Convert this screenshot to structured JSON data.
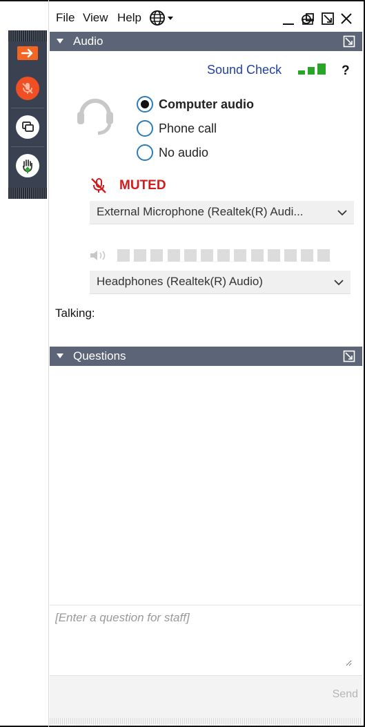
{
  "menu": {
    "file": "File",
    "view": "View",
    "help": "Help"
  },
  "window_controls": {
    "minimize_icon": "minimize-icon",
    "restore_icon": "restore-icon",
    "popout_icon": "popout-icon",
    "close_icon": "close-icon"
  },
  "toolbar": {
    "items": [
      {
        "icon": "arrow-right-icon",
        "color": "#f26522"
      },
      {
        "icon": "microphone-muted-icon",
        "color": "#f04e23"
      },
      {
        "icon": "screen-share-icon",
        "color": "#ffffff"
      },
      {
        "icon": "raise-hand-icon",
        "color": "#ffffff"
      }
    ]
  },
  "audio_panel": {
    "title": "Audio",
    "sound_check": "Sound Check",
    "help_label": "?",
    "options": [
      {
        "label": "Computer audio",
        "selected": true
      },
      {
        "label": "Phone call",
        "selected": false
      },
      {
        "label": "No audio",
        "selected": false
      }
    ],
    "mute_status": "MUTED",
    "microphone_device": "External Microphone (Realtek(R) Audi...",
    "speaker_device": "Headphones (Realtek(R) Audio)",
    "talking_label": "Talking:",
    "speaker_level_segments": 13,
    "signal_bars": 3
  },
  "questions_panel": {
    "title": "Questions",
    "input_placeholder": "[Enter a question for staff]",
    "send_label": "Send"
  },
  "colors": {
    "header_bg": "#5c6578",
    "muted_red": "#d41b1b",
    "link_blue": "#1f3fa8",
    "signal_green": "#2aa52a",
    "radio_border": "#2a7bb8"
  }
}
